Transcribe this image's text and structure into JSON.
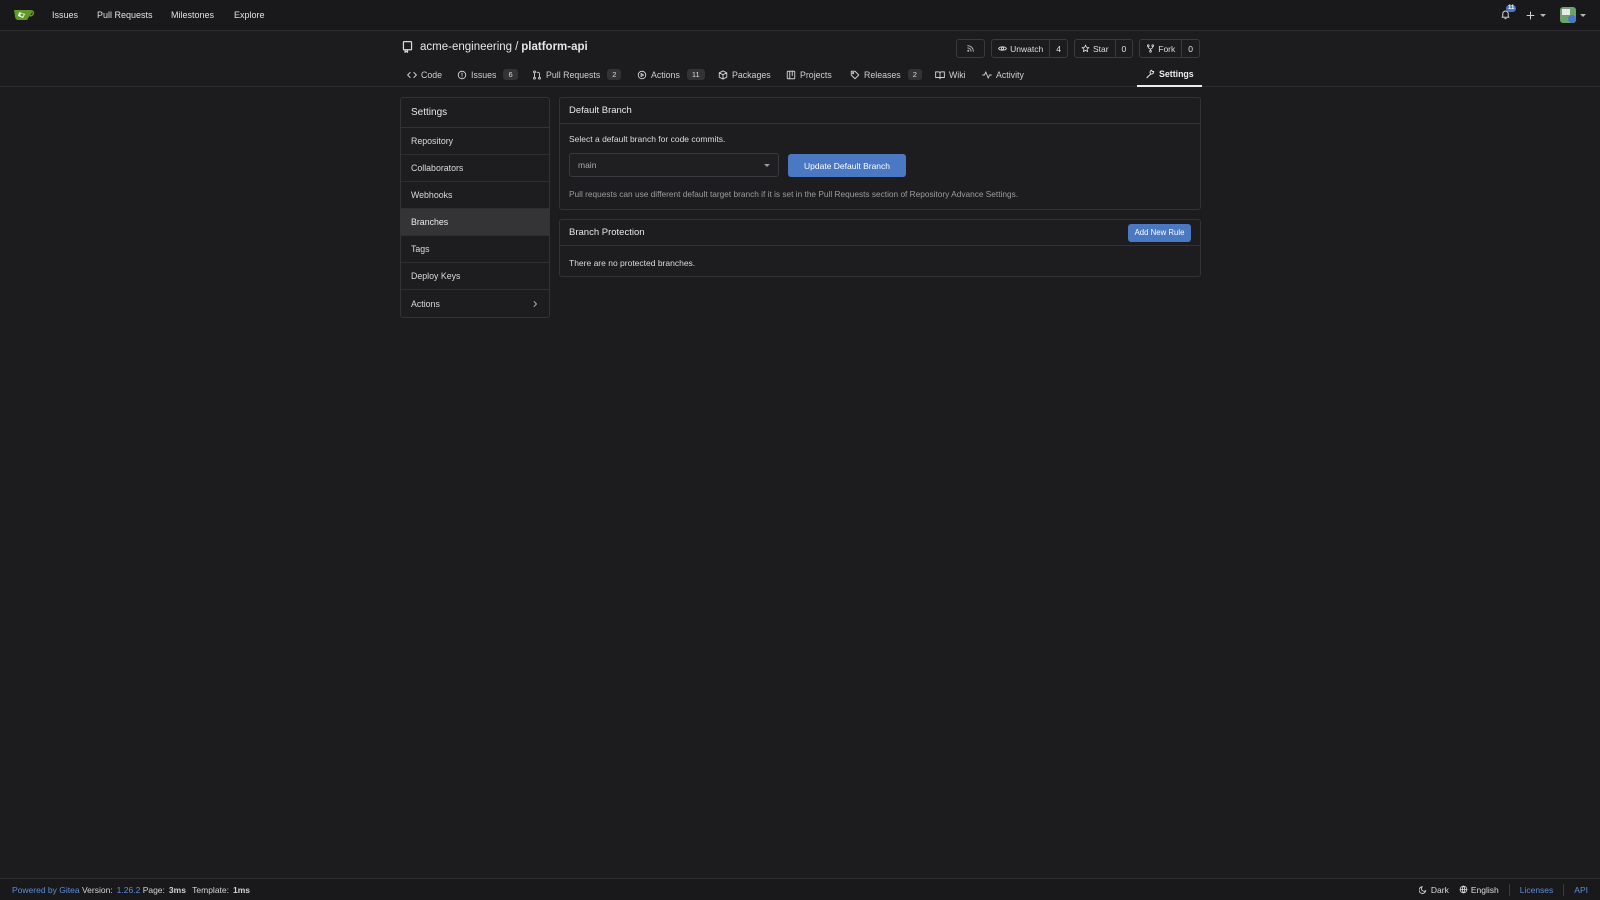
{
  "topnav": {
    "links": [
      "Issues",
      "Pull Requests",
      "Milestones",
      "Explore"
    ],
    "notification_count": "11"
  },
  "repo": {
    "owner": "acme-engineering",
    "name": "platform-api",
    "unwatch_label": "Unwatch",
    "watch_count": "4",
    "star_label": "Star",
    "star_count": "0",
    "fork_label": "Fork",
    "fork_count": "0"
  },
  "tabs": [
    {
      "label": "Code",
      "icon": "code-icon"
    },
    {
      "label": "Issues",
      "count": "6",
      "icon": "issue-icon"
    },
    {
      "label": "Pull Requests",
      "count": "2",
      "icon": "pull-request-icon"
    },
    {
      "label": "Actions",
      "count": "11",
      "icon": "play-icon"
    },
    {
      "label": "Packages",
      "icon": "package-icon"
    },
    {
      "label": "Projects",
      "icon": "project-icon"
    },
    {
      "label": "Releases",
      "count": "2",
      "icon": "tag-icon"
    },
    {
      "label": "Wiki",
      "icon": "book-icon"
    },
    {
      "label": "Activity",
      "icon": "pulse-icon"
    },
    {
      "label": "Settings",
      "icon": "tool-icon",
      "active": true
    }
  ],
  "sidebar": {
    "title": "Settings",
    "items": [
      "Repository",
      "Collaborators",
      "Webhooks",
      "Branches",
      "Tags",
      "Deploy Keys",
      "Actions"
    ],
    "active": "Branches"
  },
  "default_branch": {
    "title": "Default Branch",
    "description": "Select a default branch for code commits.",
    "selected": "main",
    "button": "Update Default Branch",
    "note": "Pull requests can use different default target branch if it is set in the Pull Requests section of Repository Advance Settings."
  },
  "branch_protection": {
    "title": "Branch Protection",
    "button": "Add New Rule",
    "empty": "There are no protected branches."
  },
  "footer": {
    "powered": "Powered by Gitea",
    "version_label": "Version:",
    "version": "1.26.2",
    "page_label": "Page:",
    "page_time": "3ms",
    "template_label": "Template:",
    "template_time": "1ms",
    "theme": "Dark",
    "language": "English",
    "licenses": "Licenses",
    "api": "API"
  },
  "colors": {
    "background": "#1c1c1e",
    "accent": "#4a78c2",
    "link": "#5b8fd8"
  }
}
